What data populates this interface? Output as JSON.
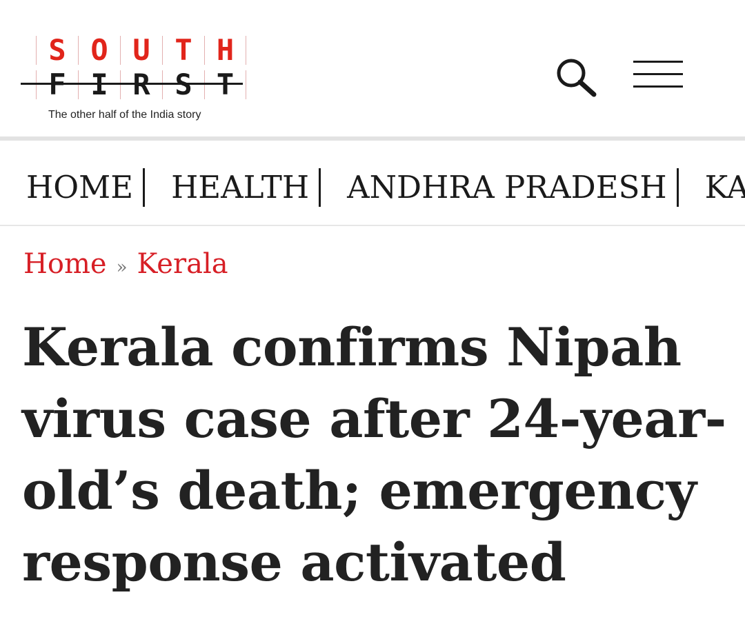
{
  "header": {
    "logo": {
      "row1": [
        "S",
        "O",
        "U",
        "T",
        "H"
      ],
      "row2": [
        "F",
        "I",
        "R",
        "S",
        "T"
      ],
      "tagline": "The other half of the India story"
    },
    "search_icon": "search-icon",
    "menu_icon": "hamburger-menu-icon",
    "colors": {
      "brand_red": "#e1251b",
      "text_dark": "#1a1a1a"
    }
  },
  "nav": {
    "items": [
      "HOME",
      "HEALTH",
      "ANDHRA PRADESH",
      "KAR"
    ]
  },
  "breadcrumb": {
    "items": [
      "Home",
      "Kerala"
    ],
    "separator": "»",
    "color": "#d71f26"
  },
  "article": {
    "title_lines": [
      "Kerala confirms Nipah",
      "virus case after 24-year-",
      "old’s death; emergency",
      "response activated"
    ]
  }
}
